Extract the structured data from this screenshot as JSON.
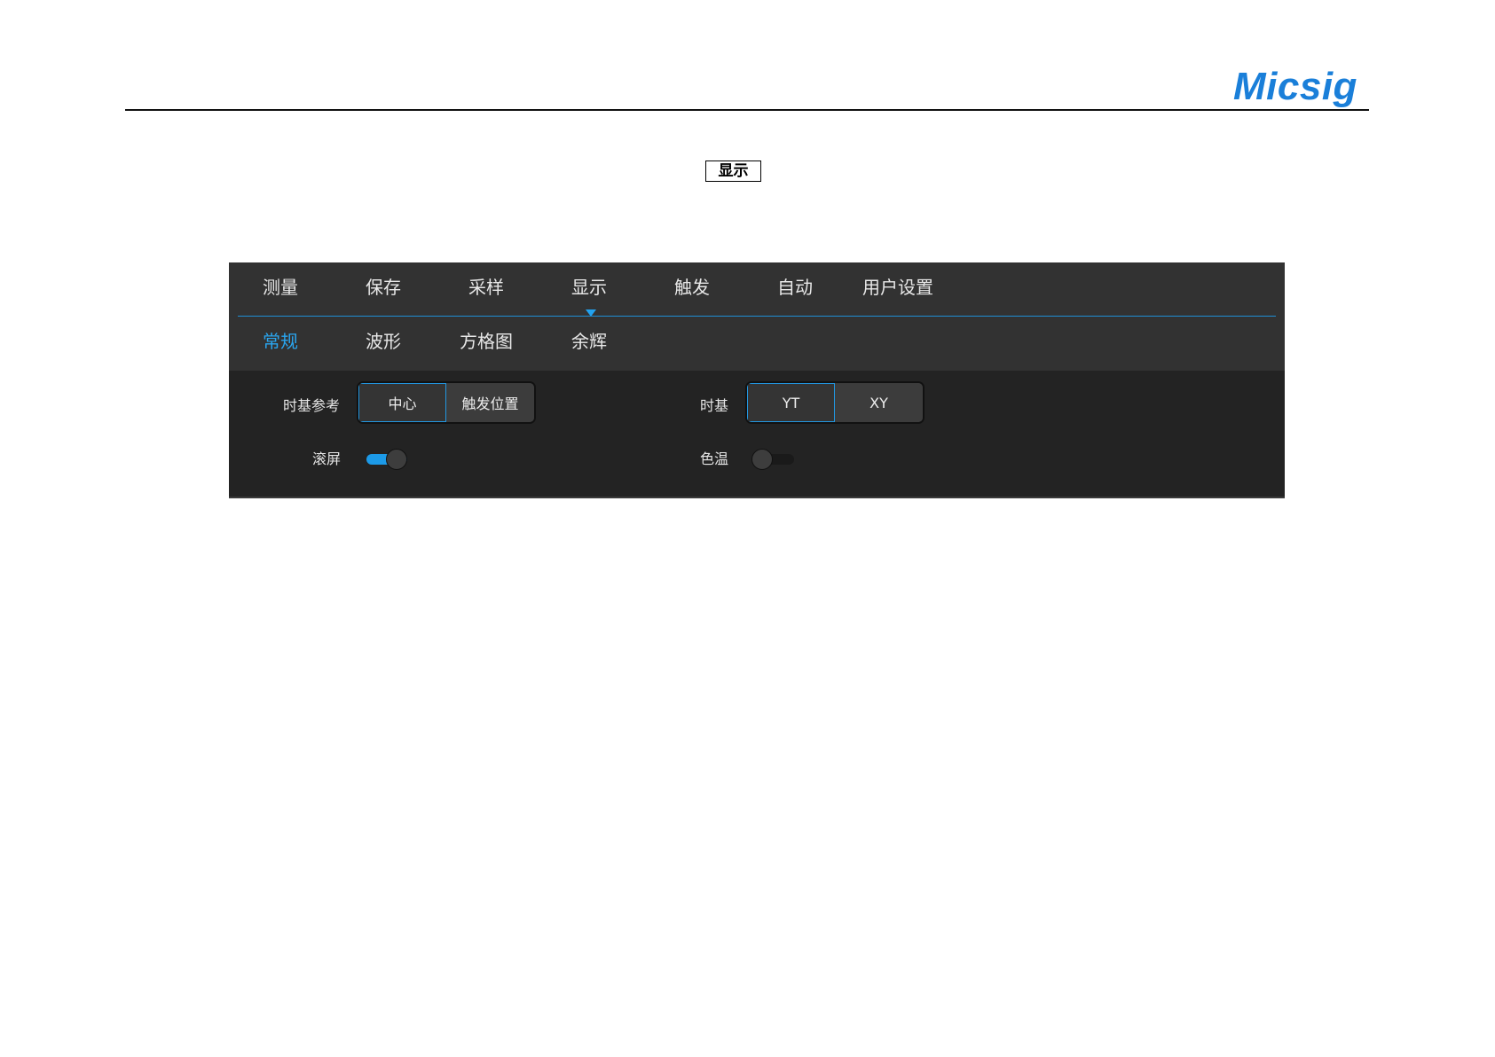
{
  "header": {
    "brand": "Micsig",
    "key_label": "显示"
  },
  "main_menu": {
    "tabs": [
      {
        "label": "测量"
      },
      {
        "label": "保存"
      },
      {
        "label": "采样"
      },
      {
        "label": "显示",
        "active": true
      },
      {
        "label": "触发"
      },
      {
        "label": "自动"
      },
      {
        "label": "用户设置"
      }
    ]
  },
  "sub_menu": {
    "tabs": [
      {
        "label": "常规",
        "active": true
      },
      {
        "label": "波形"
      },
      {
        "label": "方格图"
      },
      {
        "label": "余辉"
      }
    ]
  },
  "settings": {
    "time_ref": {
      "label": "时基参考",
      "options": [
        "中心",
        "触发位置"
      ],
      "selected": "中心"
    },
    "timebase": {
      "label": "时基",
      "options": [
        "YT",
        "XY"
      ],
      "selected": "YT"
    },
    "scroll": {
      "label": "滚屏",
      "on": true
    },
    "color_temp": {
      "label": "色温",
      "on": false
    }
  },
  "colors": {
    "brand": "#1a7fd9",
    "accent": "#22a2ef"
  }
}
